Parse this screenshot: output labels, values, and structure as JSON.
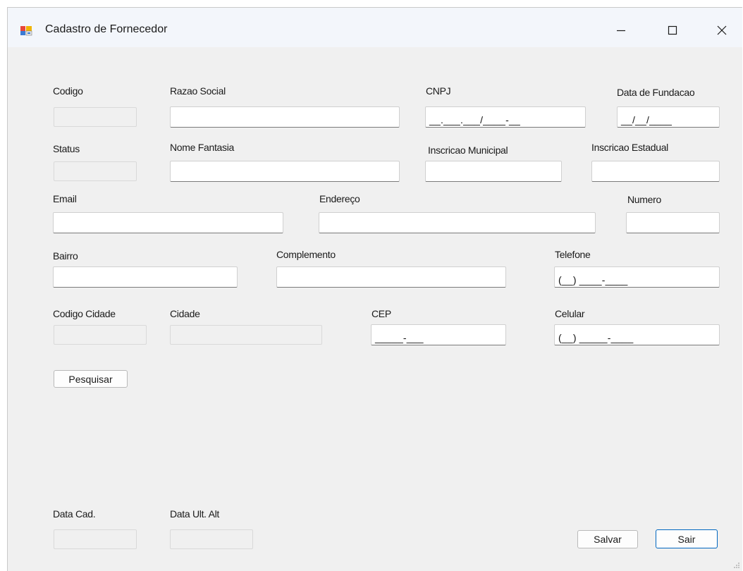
{
  "window": {
    "title": "Cadastro de Fornecedor",
    "controls": {
      "minimize": "—",
      "maximize": "☐",
      "close": "✕"
    }
  },
  "labels": {
    "codigo": "Codigo",
    "razao_social": "Razao Social",
    "cnpj": "CNPJ",
    "data_fundacao": "Data de Fundacao",
    "status": "Status",
    "nome_fantasia": "Nome Fantasia",
    "inscricao_municipal": "Inscricao Municipal",
    "inscricao_estadual": "Inscricao Estadual",
    "email": "Email",
    "endereco": "Endereço",
    "numero": "Numero",
    "bairro": "Bairro",
    "complemento": "Complemento",
    "telefone": "Telefone",
    "codigo_cidade": "Codigo Cidade",
    "cidade": "Cidade",
    "cep": "CEP",
    "celular": "Celular",
    "data_cad": "Data Cad.",
    "data_ult_alt": "Data Ult. Alt"
  },
  "values": {
    "codigo": "",
    "razao_social": "",
    "status": "",
    "nome_fantasia": "",
    "inscricao_municipal": "",
    "inscricao_estadual": "",
    "email": "",
    "endereco": "",
    "numero": "",
    "bairro": "",
    "complemento": "",
    "codigo_cidade": "",
    "cidade": "",
    "data_cad": "",
    "data_ult_alt": ""
  },
  "masks": {
    "cnpj": "__.___.___/____-__",
    "data_fundacao": "__/__/____",
    "telefone": "(__) ____-____",
    "cep": "_____-___",
    "celular": "(__) _____-____"
  },
  "buttons": {
    "pesquisar": "Pesquisar",
    "salvar": "Salvar",
    "sair": "Sair"
  },
  "colors": {
    "form_background": "#f0f0f0",
    "titlebar": "#f3f6fb",
    "default_button_border": "#0067c0"
  }
}
